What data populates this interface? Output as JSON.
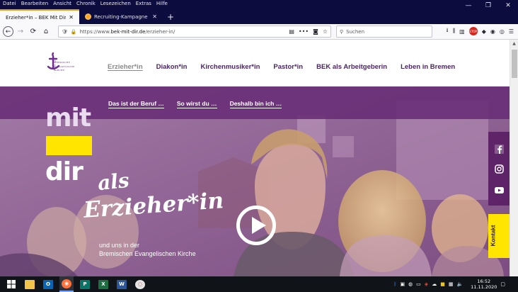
{
  "menubar": {
    "items": [
      "Datei",
      "Bearbeiten",
      "Ansicht",
      "Chronik",
      "Lesezeichen",
      "Extras",
      "Hilfe"
    ]
  },
  "tabs": [
    {
      "title": "Erzieher*in – BEK Mit Dir",
      "active": true
    },
    {
      "title": "Recruiting-Kampagne Bremisc",
      "active": false
    }
  ],
  "window_controls": {
    "minimize": "—",
    "maximize": "❐",
    "close": "✕"
  },
  "navbar": {
    "url_prefix": "https://www.",
    "url_domain": "bek-mit-dir.de",
    "url_path": "/erzieher-in/",
    "search_placeholder": "Suchen",
    "stop_badge": "STOP"
  },
  "site": {
    "logo_lines": [
      "Bremische",
      "Evangelische",
      "Kirche"
    ],
    "main_nav": [
      {
        "label": "Erzieher*in",
        "active": true
      },
      {
        "label": "Diakon*in",
        "active": false
      },
      {
        "label": "Kirchenmusiker*in",
        "active": false
      },
      {
        "label": "Pastor*in",
        "active": false
      },
      {
        "label": "BEK als Arbeitgeberin",
        "active": false
      },
      {
        "label": "Leben in Bremen",
        "active": false
      }
    ],
    "sub_nav": [
      "Das ist der Beruf …",
      "So wirst du …",
      "Deshalb bin ich …"
    ],
    "hero": {
      "word_mit": "mit",
      "word_dir": "dir",
      "handwriting_1": "als",
      "handwriting_2": "Erzieher*in",
      "subtitle_1": "und uns in der",
      "subtitle_2": "Bremischen Evangelischen Kirche"
    },
    "kontakt_label": "Kontakt"
  },
  "taskbar": {
    "apps": [
      "windows",
      "file-explorer",
      "outlook",
      "firefox",
      "publisher",
      "excel",
      "word",
      "other"
    ],
    "clock_time": "16:52",
    "clock_date": "11.11.2020"
  },
  "colors": {
    "brand_purple": "#6f2c91",
    "accent_yellow": "#ffe500",
    "tab_accent": "#e4a11b"
  }
}
